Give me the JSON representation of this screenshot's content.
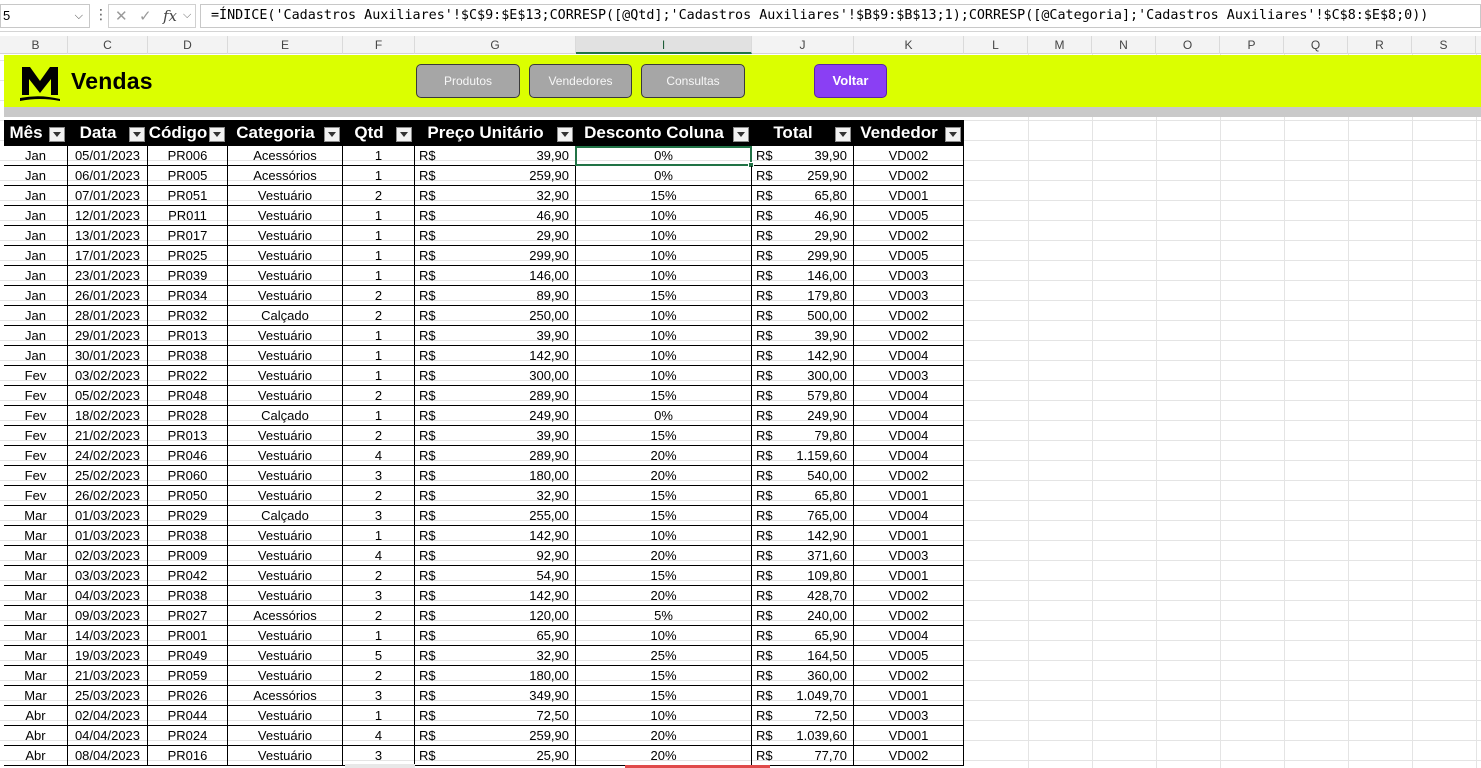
{
  "formula_bar": {
    "name_box": "5",
    "formula": "=ÍNDICE('Cadastros Auxiliares'!$C$9:$E$13;CORRESP([@Qtd];'Cadastros Auxiliares'!$B$9:$B$13;1);CORRESP([@Categoria];'Cadastros Auxiliares'!$C$8:$E$8;0))",
    "cancel_glyph": "✕",
    "enter_glyph": "✓",
    "fx_glyph": "fx"
  },
  "column_letters": [
    "B",
    "C",
    "D",
    "E",
    "F",
    "G",
    "I",
    "J",
    "K",
    "L",
    "M",
    "N",
    "O",
    "P",
    "Q",
    "R",
    "S"
  ],
  "banner": {
    "title": "Vendas",
    "logo_letter": "M",
    "buttons": [
      "Produtos",
      "Vendedores",
      "Consultas"
    ],
    "back_button": "Voltar",
    "background_color": "#dbff00",
    "accent_color": "#8a3ff4"
  },
  "table": {
    "headers": [
      "Mês",
      "Data",
      "Código",
      "Categoria",
      "Qtd",
      "Preço Unitário",
      "Desconto Coluna",
      "Total",
      "Vendedor"
    ],
    "currency": "R$",
    "rows": [
      [
        "Jan",
        "05/01/2023",
        "PR006",
        "Acessórios",
        "1",
        "39,90",
        "0%",
        "39,90",
        "VD002"
      ],
      [
        "Jan",
        "06/01/2023",
        "PR005",
        "Acessórios",
        "1",
        "259,90",
        "0%",
        "259,90",
        "VD002"
      ],
      [
        "Jan",
        "07/01/2023",
        "PR051",
        "Vestuário",
        "2",
        "32,90",
        "15%",
        "65,80",
        "VD001"
      ],
      [
        "Jan",
        "12/01/2023",
        "PR011",
        "Vestuário",
        "1",
        "46,90",
        "10%",
        "46,90",
        "VD005"
      ],
      [
        "Jan",
        "13/01/2023",
        "PR017",
        "Vestuário",
        "1",
        "29,90",
        "10%",
        "29,90",
        "VD002"
      ],
      [
        "Jan",
        "17/01/2023",
        "PR025",
        "Vestuário",
        "1",
        "299,90",
        "10%",
        "299,90",
        "VD005"
      ],
      [
        "Jan",
        "23/01/2023",
        "PR039",
        "Vestuário",
        "1",
        "146,00",
        "10%",
        "146,00",
        "VD003"
      ],
      [
        "Jan",
        "26/01/2023",
        "PR034",
        "Vestuário",
        "2",
        "89,90",
        "15%",
        "179,80",
        "VD003"
      ],
      [
        "Jan",
        "28/01/2023",
        "PR032",
        "Calçado",
        "2",
        "250,00",
        "10%",
        "500,00",
        "VD002"
      ],
      [
        "Jan",
        "29/01/2023",
        "PR013",
        "Vestuário",
        "1",
        "39,90",
        "10%",
        "39,90",
        "VD002"
      ],
      [
        "Jan",
        "30/01/2023",
        "PR038",
        "Vestuário",
        "1",
        "142,90",
        "10%",
        "142,90",
        "VD004"
      ],
      [
        "Fev",
        "03/02/2023",
        "PR022",
        "Vestuário",
        "1",
        "300,00",
        "10%",
        "300,00",
        "VD003"
      ],
      [
        "Fev",
        "05/02/2023",
        "PR048",
        "Vestuário",
        "2",
        "289,90",
        "15%",
        "579,80",
        "VD004"
      ],
      [
        "Fev",
        "18/02/2023",
        "PR028",
        "Calçado",
        "1",
        "249,90",
        "0%",
        "249,90",
        "VD004"
      ],
      [
        "Fev",
        "21/02/2023",
        "PR013",
        "Vestuário",
        "2",
        "39,90",
        "15%",
        "79,80",
        "VD004"
      ],
      [
        "Fev",
        "24/02/2023",
        "PR046",
        "Vestuário",
        "4",
        "289,90",
        "20%",
        "1.159,60",
        "VD004"
      ],
      [
        "Fev",
        "25/02/2023",
        "PR060",
        "Vestuário",
        "3",
        "180,00",
        "20%",
        "540,00",
        "VD002"
      ],
      [
        "Fev",
        "26/02/2023",
        "PR050",
        "Vestuário",
        "2",
        "32,90",
        "15%",
        "65,80",
        "VD001"
      ],
      [
        "Mar",
        "01/03/2023",
        "PR029",
        "Calçado",
        "3",
        "255,00",
        "15%",
        "765,00",
        "VD004"
      ],
      [
        "Mar",
        "01/03/2023",
        "PR038",
        "Vestuário",
        "1",
        "142,90",
        "10%",
        "142,90",
        "VD001"
      ],
      [
        "Mar",
        "02/03/2023",
        "PR009",
        "Vestuário",
        "4",
        "92,90",
        "20%",
        "371,60",
        "VD003"
      ],
      [
        "Mar",
        "03/03/2023",
        "PR042",
        "Vestuário",
        "2",
        "54,90",
        "15%",
        "109,80",
        "VD001"
      ],
      [
        "Mar",
        "04/03/2023",
        "PR038",
        "Vestuário",
        "3",
        "142,90",
        "20%",
        "428,70",
        "VD002"
      ],
      [
        "Mar",
        "09/03/2023",
        "PR027",
        "Acessórios",
        "2",
        "120,00",
        "5%",
        "240,00",
        "VD002"
      ],
      [
        "Mar",
        "14/03/2023",
        "PR001",
        "Vestuário",
        "1",
        "65,90",
        "10%",
        "65,90",
        "VD004"
      ],
      [
        "Mar",
        "19/03/2023",
        "PR049",
        "Vestuário",
        "5",
        "32,90",
        "25%",
        "164,50",
        "VD005"
      ],
      [
        "Mar",
        "21/03/2023",
        "PR059",
        "Vestuário",
        "2",
        "180,00",
        "15%",
        "360,00",
        "VD002"
      ],
      [
        "Mar",
        "25/03/2023",
        "PR026",
        "Acessórios",
        "3",
        "349,90",
        "15%",
        "1.049,70",
        "VD001"
      ],
      [
        "Abr",
        "02/04/2023",
        "PR044",
        "Vestuário",
        "1",
        "72,50",
        "10%",
        "72,50",
        "VD003"
      ],
      [
        "Abr",
        "04/04/2023",
        "PR024",
        "Vestuário",
        "4",
        "259,90",
        "20%",
        "1.039,60",
        "VD001"
      ],
      [
        "Abr",
        "08/04/2023",
        "PR016",
        "Vestuário",
        "3",
        "25,90",
        "20%",
        "77,70",
        "VD002"
      ]
    ]
  }
}
